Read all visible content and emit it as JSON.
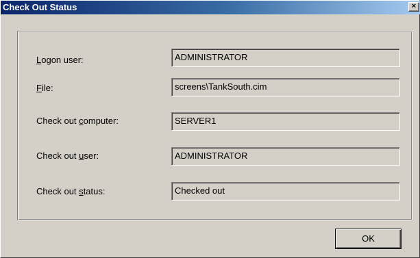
{
  "window": {
    "title": "Check Out Status",
    "close_glyph": "×"
  },
  "fields": [
    {
      "label_prefix": "",
      "label_accel": "L",
      "label_suffix": "ogon user:",
      "value": "ADMINISTRATOR"
    },
    {
      "label_prefix": "",
      "label_accel": "F",
      "label_suffix": "ile:",
      "value": "screens\\TankSouth.cim"
    },
    {
      "label_prefix": "Check out ",
      "label_accel": "c",
      "label_suffix": "omputer:",
      "value": "SERVER1"
    },
    {
      "label_prefix": "Check out ",
      "label_accel": "u",
      "label_suffix": "ser:",
      "value": "ADMINISTRATOR"
    },
    {
      "label_prefix": "Check out ",
      "label_accel": "s",
      "label_suffix": "tatus:",
      "value": "Checked out"
    }
  ],
  "buttons": {
    "ok_label": "OK"
  }
}
